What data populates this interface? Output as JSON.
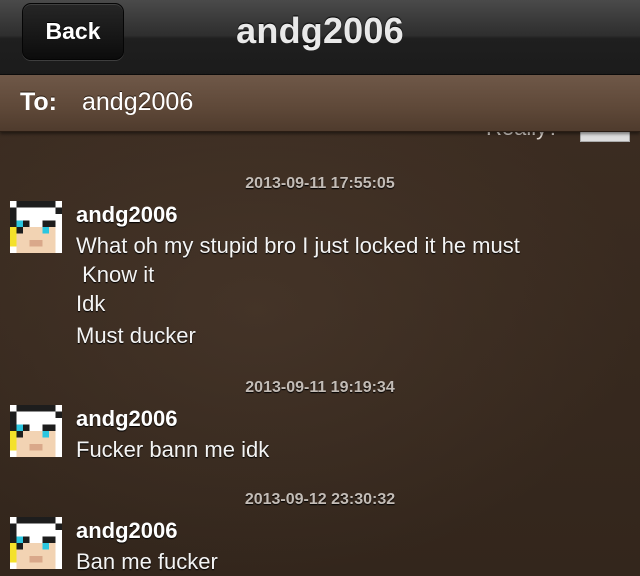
{
  "nav": {
    "back_label": "Back",
    "title": "andg2006"
  },
  "compose": {
    "to_label": "To:",
    "to_value": "andg2006"
  },
  "thread": {
    "peek_text": "Really?",
    "messages": [
      {
        "timestamp": "2013-09-11 17:55:05",
        "sender": "andg2006",
        "lines": [
          "What oh my stupid bro I just locked it he must",
          " Know it",
          "Idk",
          "Must ducker"
        ]
      },
      {
        "timestamp": "2013-09-11 19:19:34",
        "sender": "andg2006",
        "lines": [
          "Fucker bann me idk"
        ]
      },
      {
        "timestamp": "2013-09-12 23:30:32",
        "sender": "andg2006",
        "lines": [
          "Ban me fucker"
        ]
      }
    ]
  },
  "colors": {
    "nav_bg": "#2b2b2b",
    "to_bar_bg": "#5e4838",
    "feed_bg": "#3a2b20",
    "timestamp": "#c3bcb6",
    "text": "#ffffff"
  }
}
